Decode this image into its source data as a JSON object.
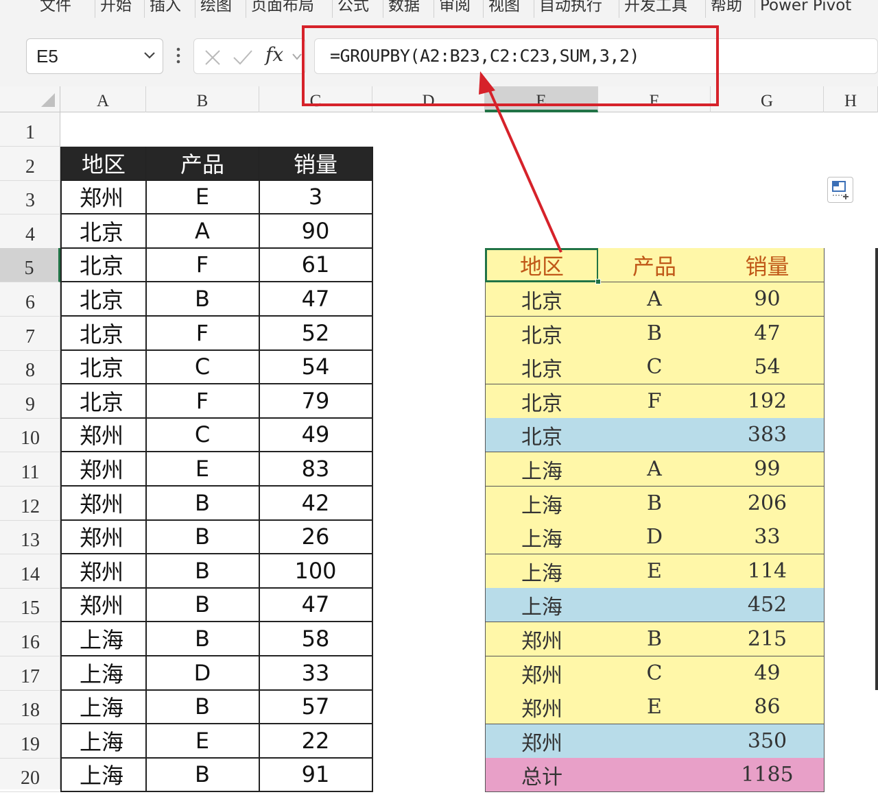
{
  "ribbon": {
    "tabs": [
      "文件",
      "开始",
      "插入",
      "绘图",
      "页面布局",
      "公式",
      "数据",
      "审阅",
      "视图",
      "自动执行",
      "开发工具",
      "帮助",
      "Power Pivot"
    ]
  },
  "formula_bar": {
    "name_box": "E5",
    "fx_label": "fx",
    "formula": "=GROUPBY(A2:B23,C2:C23,SUM,3,2)"
  },
  "columns": [
    "A",
    "B",
    "C",
    "D",
    "E",
    "F",
    "G",
    "H"
  ],
  "rows": [
    "1",
    "2",
    "3",
    "4",
    "5",
    "6",
    "7",
    "8",
    "9",
    "10",
    "11",
    "12",
    "13",
    "14",
    "15",
    "16",
    "17",
    "18",
    "19",
    "20"
  ],
  "source_table": {
    "headers": [
      "地区",
      "产品",
      "销量"
    ],
    "rows": [
      [
        "郑州",
        "E",
        "3"
      ],
      [
        "北京",
        "A",
        "90"
      ],
      [
        "北京",
        "F",
        "61"
      ],
      [
        "北京",
        "B",
        "47"
      ],
      [
        "北京",
        "F",
        "52"
      ],
      [
        "北京",
        "C",
        "54"
      ],
      [
        "北京",
        "F",
        "79"
      ],
      [
        "郑州",
        "C",
        "49"
      ],
      [
        "郑州",
        "E",
        "83"
      ],
      [
        "郑州",
        "B",
        "42"
      ],
      [
        "郑州",
        "B",
        "26"
      ],
      [
        "郑州",
        "B",
        "100"
      ],
      [
        "郑州",
        "B",
        "47"
      ],
      [
        "上海",
        "B",
        "58"
      ],
      [
        "上海",
        "D",
        "33"
      ],
      [
        "上海",
        "B",
        "57"
      ],
      [
        "上海",
        "E",
        "22"
      ],
      [
        "上海",
        "B",
        "91"
      ]
    ]
  },
  "result_table": {
    "headers": [
      "地区",
      "产品",
      "销量"
    ],
    "rows": [
      {
        "cells": [
          "北京",
          "A",
          "90"
        ],
        "kind": "detail"
      },
      {
        "cells": [
          "北京",
          "B",
          "47"
        ],
        "kind": "detail"
      },
      {
        "cells": [
          "北京",
          "C",
          "54"
        ],
        "kind": "detail"
      },
      {
        "cells": [
          "北京",
          "F",
          "192"
        ],
        "kind": "detail"
      },
      {
        "cells": [
          "北京",
          "",
          "383"
        ],
        "kind": "subtotal"
      },
      {
        "cells": [
          "上海",
          "A",
          "99"
        ],
        "kind": "detail"
      },
      {
        "cells": [
          "上海",
          "B",
          "206"
        ],
        "kind": "detail"
      },
      {
        "cells": [
          "上海",
          "D",
          "33"
        ],
        "kind": "detail"
      },
      {
        "cells": [
          "上海",
          "E",
          "114"
        ],
        "kind": "detail"
      },
      {
        "cells": [
          "上海",
          "",
          "452"
        ],
        "kind": "subtotal"
      },
      {
        "cells": [
          "郑州",
          "B",
          "215"
        ],
        "kind": "detail"
      },
      {
        "cells": [
          "郑州",
          "C",
          "49"
        ],
        "kind": "detail"
      },
      {
        "cells": [
          "郑州",
          "E",
          "86"
        ],
        "kind": "detail"
      },
      {
        "cells": [
          "郑州",
          "",
          "350"
        ],
        "kind": "subtotal"
      },
      {
        "cells": [
          "总计",
          "",
          "1185"
        ],
        "kind": "total"
      }
    ]
  },
  "colors": {
    "source_header_bg": "#262626",
    "detail_bg": "#fff7a8",
    "subtotal_bg": "#b8dce9",
    "total_bg": "#e8a0c8",
    "result_header_text": "#c05818",
    "annotation_red": "#d6222a",
    "selection_green": "#217346"
  },
  "icons": [
    "chevron-down-icon",
    "more-dots-icon",
    "cancel-x-icon",
    "confirm-check-icon",
    "quick-analysis-icon"
  ]
}
